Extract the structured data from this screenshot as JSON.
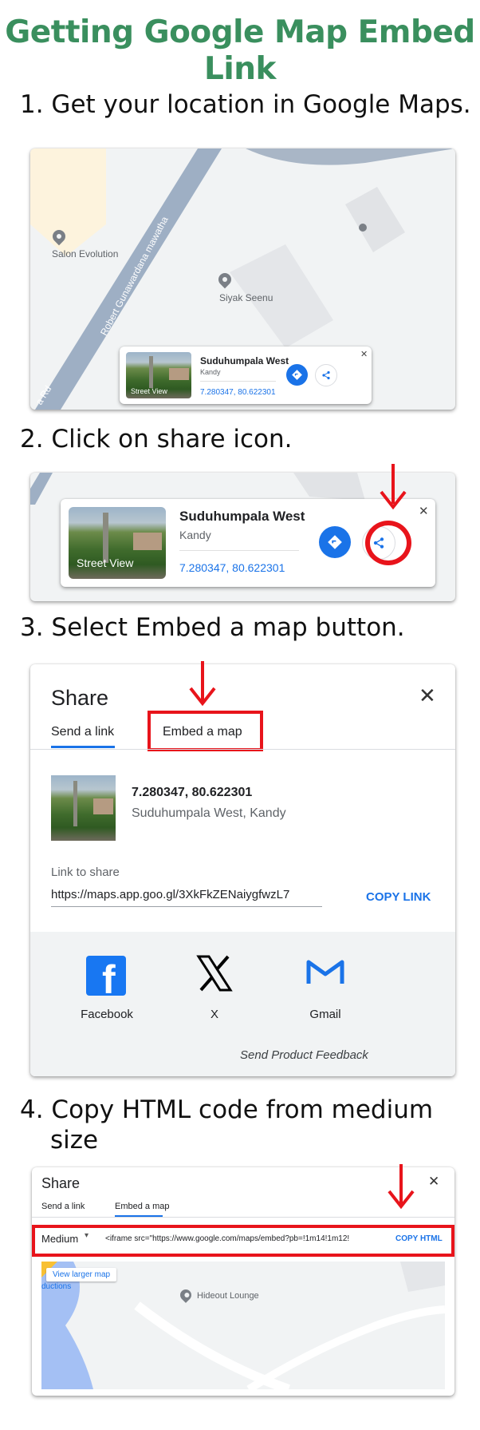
{
  "title": "Getting Google Map Embed Link",
  "steps": {
    "s1": "1. Get your location in Google Maps.",
    "s2": "2. Click on share icon.",
    "s3": "3. Select Embed a map button.",
    "s4_line1": "4. Copy HTML code from medium",
    "s4_line2": "size"
  },
  "map1": {
    "road_label": "Robert Gunawardana mawatha",
    "road2_label": "a Rd",
    "place1": "Salon Evolution",
    "place2": "Siyak Seenu"
  },
  "place_card": {
    "name": "Suduhumpala West",
    "area": "Kandy",
    "coords": "7.280347, 80.622301",
    "street_view": "Street View",
    "close": "✕"
  },
  "share_dialog": {
    "title": "Share",
    "tab_send": "Send a link",
    "tab_embed": "Embed a map",
    "close": "✕",
    "coords": "7.280347, 80.622301",
    "place": "Suduhumpala West, Kandy",
    "link_label": "Link to share",
    "link": "https://maps.app.goo.gl/3XkFkZENaiygfwzL7",
    "copy_link": "COPY LINK",
    "social": [
      {
        "label": "Facebook",
        "icon": "facebook-icon"
      },
      {
        "label": "X",
        "icon": "x-icon"
      },
      {
        "label": "Gmail",
        "icon": "gmail-icon"
      }
    ],
    "feedback": "Send Product Feedback"
  },
  "embed_dialog": {
    "title": "Share",
    "tab_send": "Send a link",
    "tab_embed": "Embed a map",
    "close": "✕",
    "size": "Medium",
    "iframe_code": "<iframe src=\"https://www.google.com/maps/embed?pb=!1m14!1m12!",
    "copy_html": "COPY HTML",
    "view_larger": "View larger map",
    "place": "Hideout Lounge",
    "edge_label": "ductions"
  },
  "colors": {
    "title_green": "#3a8f5e",
    "accent_red": "#e8141b",
    "google_blue": "#1a73e8"
  }
}
